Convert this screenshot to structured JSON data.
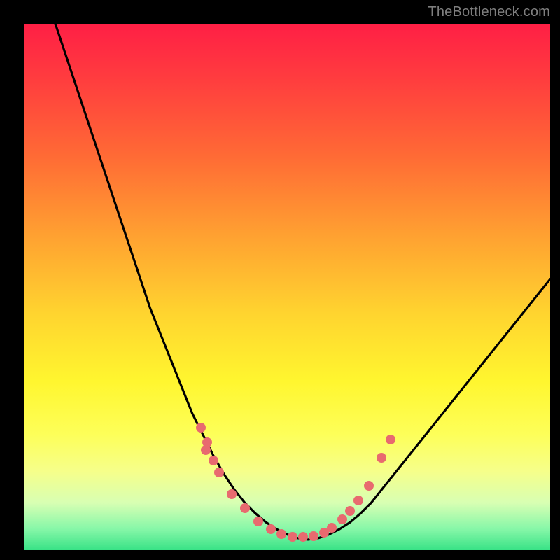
{
  "watermark": "TheBottleneck.com",
  "colors": {
    "frame_bg": "#000000",
    "gradient_top": "#ff1f45",
    "gradient_bottom": "#38e286",
    "curve_stroke": "#000000",
    "dot_fill": "#e86a6f"
  },
  "chart_data": {
    "type edx": null,
    "type": "line",
    "title": "",
    "xlabel": "",
    "ylabel": "",
    "xlim": [
      0,
      100
    ],
    "ylim": [
      0,
      100
    ],
    "grid": false,
    "legend": false,
    "series": [
      {
        "name": "curve",
        "x": [
          6,
          8,
          10,
          12,
          14,
          16,
          18,
          20,
          22,
          24,
          26,
          28,
          30,
          32,
          34,
          36,
          38,
          40,
          42,
          44,
          46,
          48,
          50,
          52,
          54,
          56,
          58,
          60,
          62,
          64,
          66,
          68,
          70,
          72,
          74,
          76,
          78,
          80,
          82,
          84,
          86,
          88,
          90,
          92,
          94,
          96,
          98,
          100
        ],
        "y": [
          100,
          94,
          88,
          82,
          76,
          70,
          64,
          58,
          52,
          46,
          41,
          36,
          31,
          26,
          22,
          18,
          14.5,
          11.5,
          9,
          7,
          5.3,
          4,
          3,
          2.3,
          2,
          2.3,
          3,
          4,
          5.3,
          7,
          9,
          11.5,
          14,
          16.5,
          19,
          21.5,
          24,
          26.5,
          29,
          31.5,
          34,
          36.5,
          39,
          41.5,
          44,
          46.5,
          49,
          51.5
        ]
      }
    ],
    "dots": {
      "name": "data-points",
      "x": [
        33.6,
        34.8,
        34.6,
        36.0,
        37.1,
        39.5,
        42.0,
        44.5,
        47.0,
        49.0,
        51.0,
        53.0,
        55.0,
        57.0,
        58.5,
        60.5,
        62.0,
        63.5,
        65.5,
        68.0,
        69.7
      ],
      "y": [
        23.3,
        20.5,
        19.0,
        17.0,
        14.8,
        10.7,
        8.0,
        5.5,
        4.0,
        3.0,
        2.5,
        2.5,
        2.6,
        3.3,
        4.3,
        5.8,
        7.5,
        9.5,
        12.3,
        17.5,
        21.0
      ]
    }
  }
}
